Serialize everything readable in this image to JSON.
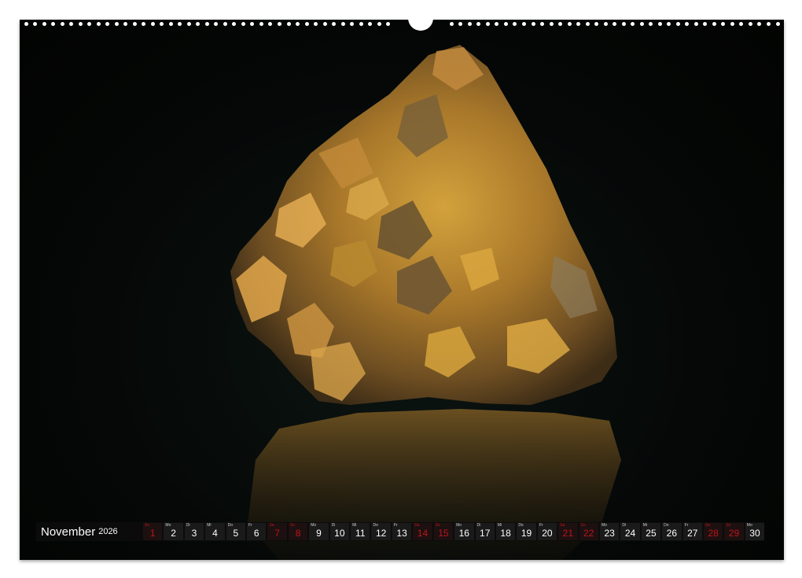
{
  "calendar": {
    "month": "November",
    "year": "2026",
    "days": [
      {
        "wd": "So",
        "num": "1",
        "weekend": true
      },
      {
        "wd": "Mo",
        "num": "2",
        "weekend": false
      },
      {
        "wd": "Di",
        "num": "3",
        "weekend": false
      },
      {
        "wd": "Mi",
        "num": "4",
        "weekend": false
      },
      {
        "wd": "Do",
        "num": "5",
        "weekend": false
      },
      {
        "wd": "Fr",
        "num": "6",
        "weekend": false
      },
      {
        "wd": "Sa",
        "num": "7",
        "weekend": true
      },
      {
        "wd": "So",
        "num": "8",
        "weekend": true
      },
      {
        "wd": "Mo",
        "num": "9",
        "weekend": false
      },
      {
        "wd": "Di",
        "num": "10",
        "weekend": false
      },
      {
        "wd": "Mi",
        "num": "11",
        "weekend": false
      },
      {
        "wd": "Do",
        "num": "12",
        "weekend": false
      },
      {
        "wd": "Fr",
        "num": "13",
        "weekend": false
      },
      {
        "wd": "Sa",
        "num": "14",
        "weekend": true
      },
      {
        "wd": "So",
        "num": "15",
        "weekend": true
      },
      {
        "wd": "Mo",
        "num": "16",
        "weekend": false
      },
      {
        "wd": "Di",
        "num": "17",
        "weekend": false
      },
      {
        "wd": "Mi",
        "num": "18",
        "weekend": false
      },
      {
        "wd": "Do",
        "num": "19",
        "weekend": false
      },
      {
        "wd": "Fr",
        "num": "20",
        "weekend": false
      },
      {
        "wd": "Sa",
        "num": "21",
        "weekend": true
      },
      {
        "wd": "So",
        "num": "22",
        "weekend": true
      },
      {
        "wd": "Mo",
        "num": "23",
        "weekend": false
      },
      {
        "wd": "Di",
        "num": "24",
        "weekend": false
      },
      {
        "wd": "Mi",
        "num": "25",
        "weekend": false
      },
      {
        "wd": "Do",
        "num": "26",
        "weekend": false
      },
      {
        "wd": "Fr",
        "num": "27",
        "weekend": false
      },
      {
        "wd": "Sa",
        "num": "28",
        "weekend": true
      },
      {
        "wd": "So",
        "num": "29",
        "weekend": true
      },
      {
        "wd": "Mo",
        "num": "30",
        "weekend": false
      }
    ]
  },
  "colors": {
    "background": "#050807",
    "weekend": "#c0141a",
    "mineral": "#c9902e"
  }
}
